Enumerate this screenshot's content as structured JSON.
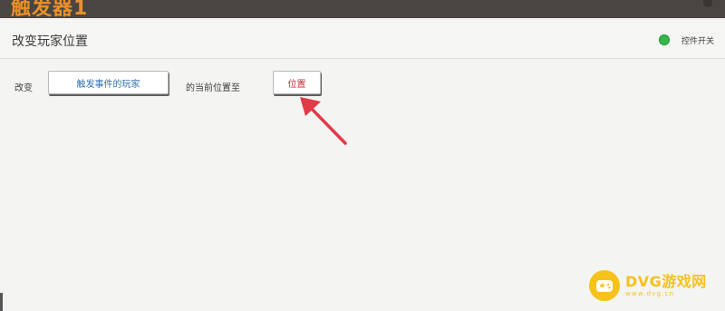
{
  "window": {
    "title": "触发器1"
  },
  "panel": {
    "title": "改变玩家位置",
    "toggle": {
      "label": "控件开关",
      "color": "#35b64a",
      "on": true
    }
  },
  "action_row": {
    "prefix": "改变",
    "player_param": "触发事件的玩家",
    "middle": "的当前位置至",
    "position_param": "位置"
  },
  "annotation": {
    "arrow_color": "#e23a47"
  },
  "watermark": {
    "title": "DVG游戏网",
    "subtitle": "www.dvg.cn",
    "color": "#f6c21b",
    "icon": "gamepad-icon"
  }
}
